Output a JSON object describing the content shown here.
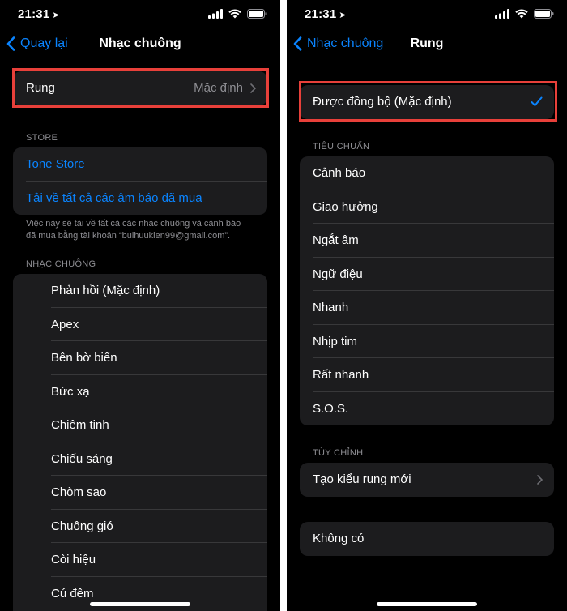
{
  "left": {
    "status_time": "21:31",
    "back_label": "Quay lại",
    "title": "Nhạc chuông",
    "vibration_row": {
      "label": "Rung",
      "value": "Mặc định"
    },
    "store_header": "STORE",
    "store_items": [
      "Tone Store",
      "Tải về tất cả các âm báo đã mua"
    ],
    "store_footer_line1": "Việc này sẽ tải về tất cả các nhạc chuông và cảnh báo",
    "store_footer_line2": "đã mua bằng tài khoản “buihuukien99@gmail.com”.",
    "ringtones_header": "NHẠC CHUÔNG",
    "ringtones": [
      "Phản hồi (Mặc định)",
      "Apex",
      "Bên bờ biển",
      "Bức xạ",
      "Chiêm tinh",
      "Chiếu sáng",
      "Chòm sao",
      "Chuông gió",
      "Còi hiệu",
      "Cú đêm"
    ]
  },
  "right": {
    "status_time": "21:31",
    "back_label": "Nhạc chuông",
    "title": "Rung",
    "synced_option": "Được đồng bộ (Mặc định)",
    "standard_header": "TIÊU CHUẨN",
    "standard_items": [
      "Cảnh báo",
      "Giao hưởng",
      "Ngắt âm",
      "Ngữ điệu",
      "Nhanh",
      "Nhịp tim",
      "Rất nhanh",
      "S.O.S."
    ],
    "custom_header": "TÙY CHỈNH",
    "custom_item": "Tạo kiểu rung mới",
    "none_item": "Không có"
  },
  "colors": {
    "accent": "#0a84ff",
    "highlight": "#e8403a",
    "cell": "#1c1c1e"
  },
  "icons": [
    "location-arrow-icon",
    "signal-icon",
    "wifi-icon",
    "battery-icon",
    "back-chevron-icon",
    "chevron-right-icon",
    "checkmark-icon"
  ]
}
